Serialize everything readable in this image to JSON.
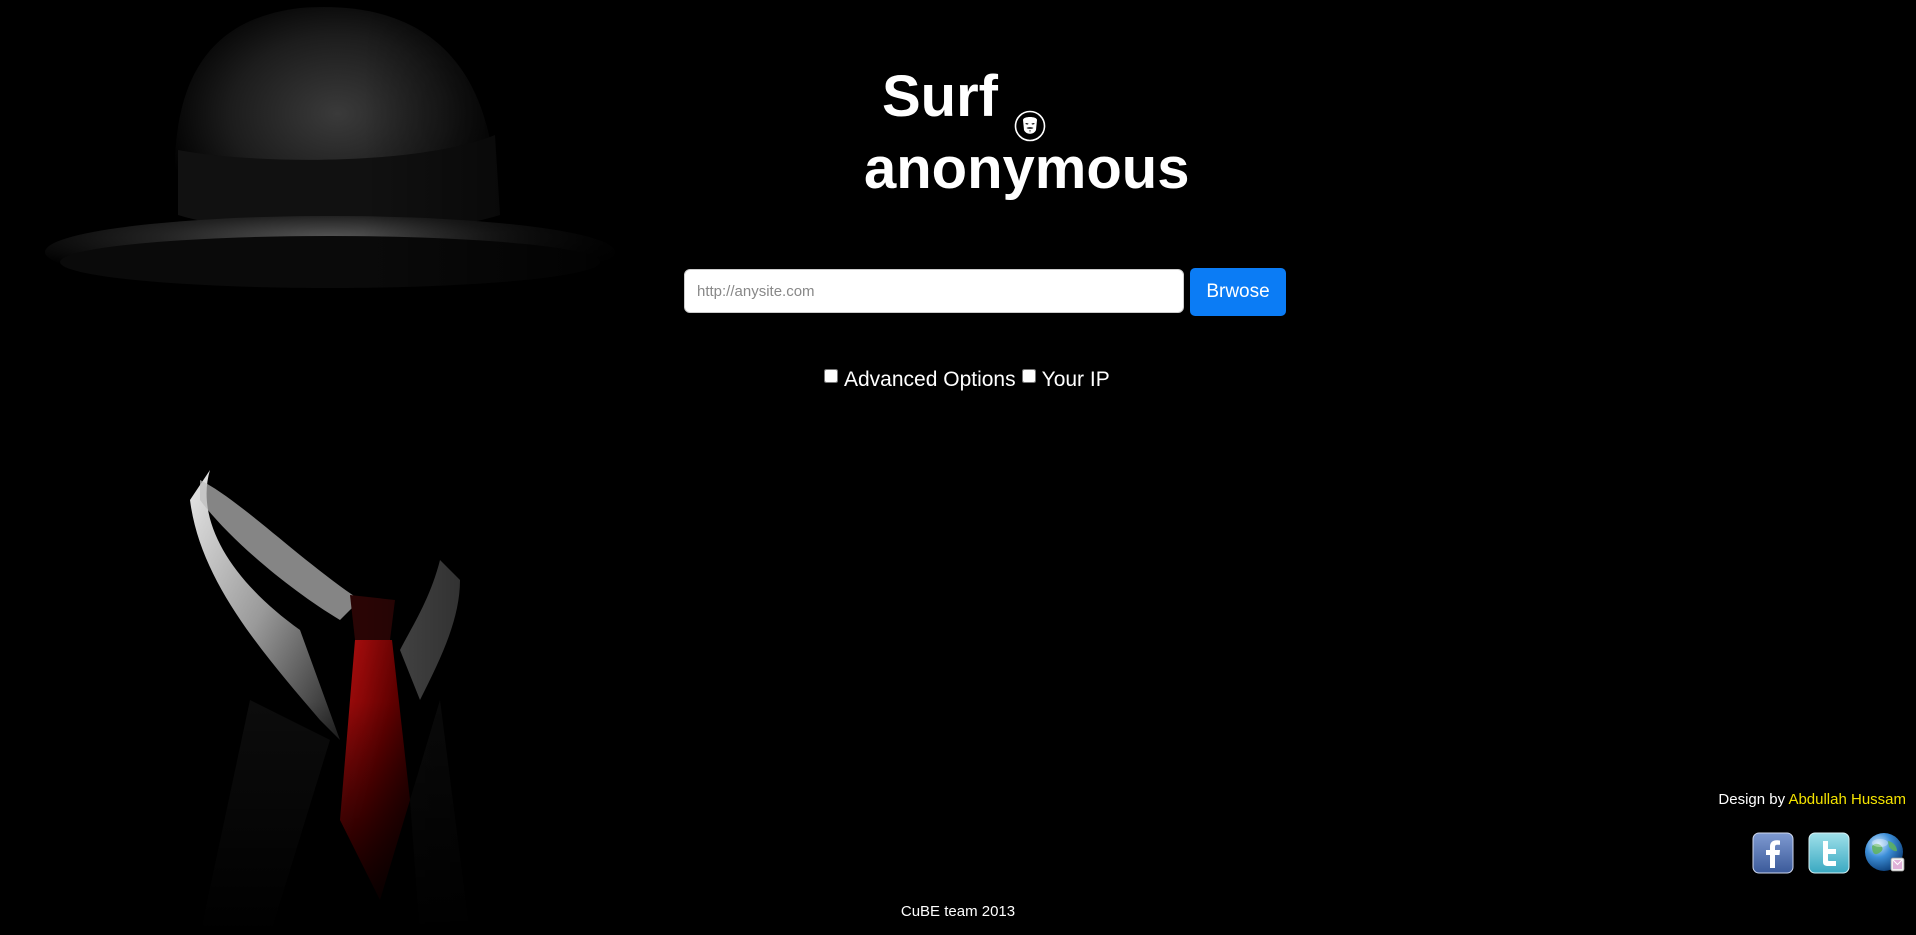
{
  "header": {
    "title_line1": "Surf",
    "title_line2": "anonymous",
    "title_icon": "anonymous-mask-icon"
  },
  "search": {
    "placeholder": "http://anysite.com",
    "value": "",
    "button_label": "Brwose"
  },
  "options": {
    "advanced_label": "Advanced Options",
    "advanced_checked": false,
    "your_ip_label": "Your IP",
    "your_ip_checked": false
  },
  "credit": {
    "prefix": "Design by",
    "author": "Abdullah Hussam"
  },
  "social": {
    "icons": [
      "facebook-icon",
      "twitter-icon",
      "globe-icon"
    ]
  },
  "footer": {
    "text": "CuBE team 2013"
  },
  "colors": {
    "background": "#000000",
    "button": "#0b7cf5",
    "author_link": "#f4e300",
    "tie": "#8b0000"
  }
}
